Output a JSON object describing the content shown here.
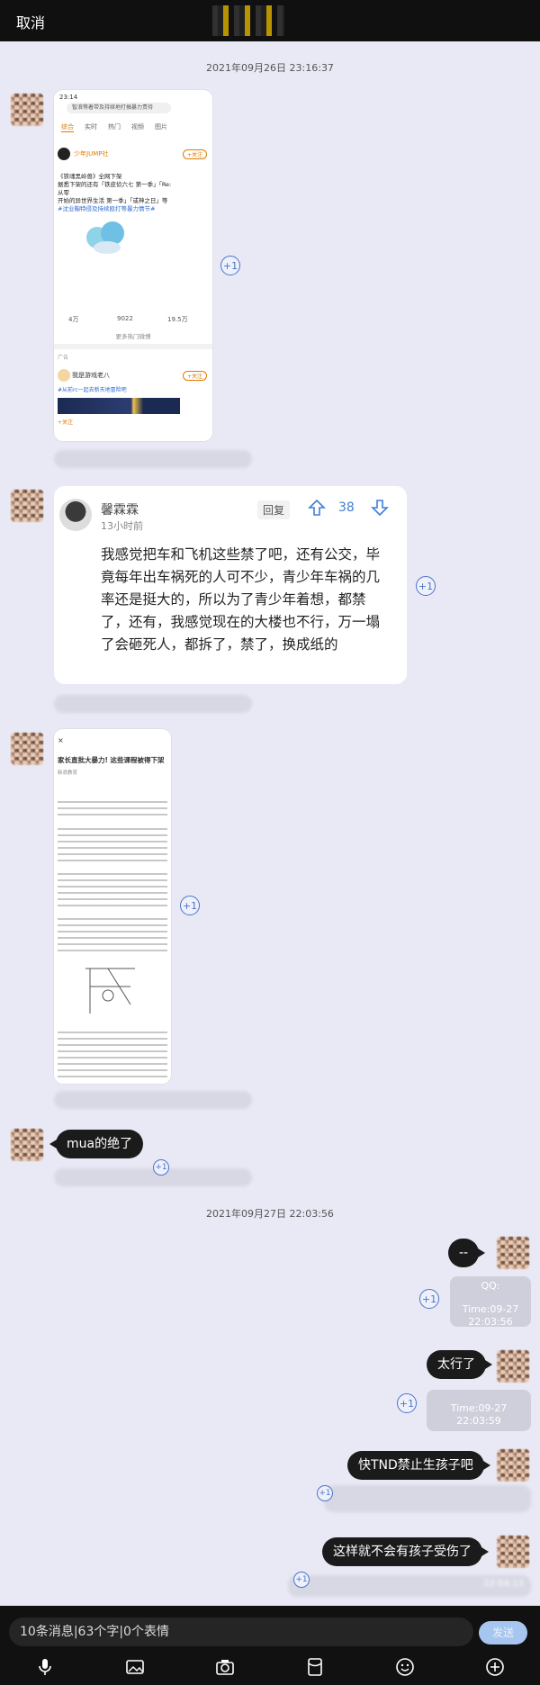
{
  "topbar": {
    "cancel_label": "取消"
  },
  "timestamps": [
    "2021年09月26日 23:16:37",
    "2021年09月27日 22:03:56"
  ],
  "plus_label": "+1",
  "screenshot1": {
    "status": "23:14",
    "search_text": "智浪等着带及持续地打搞暴力责待",
    "tabs": [
      "综合",
      "实时",
      "热门",
      "视频",
      "图片"
    ],
    "author": "少年JUMP社",
    "follow_label": "+关注",
    "body_line1": "《铁魂黑岭兽》全网下架",
    "body_line2": "据悉下架的还有「铁皮侦六七 第一季」「Re:从零",
    "body_line3": "开始的异世界生活 第一季」「或神之日」等",
    "body_link": "#沈业鞠特侵下架#",
    "body_link2": "#沈业鞠特侵及持续殴打等暴力情节#",
    "stat_repost": "4万",
    "stat_comment": "9022",
    "stat_like": "19.5万",
    "more_label": "更多热门微博",
    "ad_label": "广告",
    "ad_name": "我是游戏老八",
    "ad_follow": "+关注",
    "ad_link": "#从前rc一起去新天地冒险吧",
    "ad_footer": "+关注"
  },
  "comment": {
    "name": "馨霖霖",
    "time": "13小时前",
    "reply_label": "回复",
    "votes": "38",
    "text": "我感觉把车和飞机这些禁了吧，还有公交，毕竟每年出车祸死的人可不少，青少年车祸的几率还是挺大的，所以为了青少年着想，都禁了，还有，我感觉现在的大楼也不行，万一塌了会砸死人，都拆了，禁了，换成纸的"
  },
  "screenshot3": {
    "close": "×",
    "headline": "家长直批大暴力! 这些课程被得下架",
    "subline": "新浪教育"
  },
  "messages": {
    "left_mua": "mua的绝了",
    "right1": "--",
    "right2": "太行了",
    "right3": "快TND禁止生孩子吧",
    "right4": "这样就不会有孩子受伤了"
  },
  "side_info": {
    "qq_label": "QQ:",
    "time1": "Time:09-27",
    "time1b": "22:03:56",
    "time2": "Time:09-27",
    "time2b": "22:03:59",
    "time3": "22:04:13"
  },
  "bottom": {
    "input_text": "10条消息|63个字|0个表情",
    "send_label": "发送"
  },
  "icons": [
    "mic-icon",
    "image-icon",
    "camera-icon",
    "red-packet-icon",
    "emoji-icon",
    "plus-circle-icon"
  ]
}
